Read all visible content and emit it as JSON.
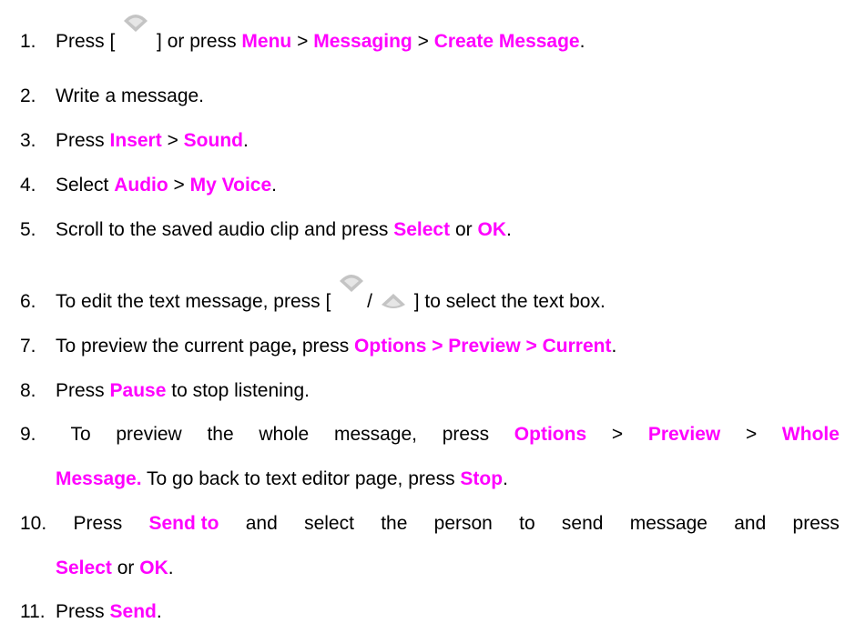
{
  "steps": [
    {
      "num": "1.",
      "t1": "Press [",
      "t2": "] or press",
      "h1": "Menu",
      "sep1": ">",
      "h2": "Messaging",
      "sep2": ">",
      "h3": "Create Message",
      "end": ".",
      "icon": "nav-up-key-icon"
    },
    {
      "num": "2.",
      "t1": "Write a message."
    },
    {
      "num": "3.",
      "t1": "Press",
      "h1": "Insert",
      "sep1": ">",
      "h2": "Sound",
      "end": "."
    },
    {
      "num": "4.",
      "t1": "Select",
      "h1": "Audio",
      "sep1": ">",
      "h2": "My Voice",
      "end": "."
    },
    {
      "num": "5.",
      "t1": "Scroll to the saved audio clip and press",
      "h1": "Select",
      "t2": "or",
      "h2": "OK",
      "end": "."
    },
    {
      "num": "6.",
      "t1": "To edit the text message, press [",
      "slash": "/",
      "t2": "] to select the text box.",
      "icon1": "nav-up-key-icon",
      "icon2": "nav-down-key-icon"
    },
    {
      "num": "7.",
      "t1": "To preview the current page",
      "comma": ",",
      "t2": "press",
      "h1": "Options > Preview > Current",
      "end": "."
    },
    {
      "num": "8.",
      "t1": "Press",
      "h1": "Pause",
      "t2": "to stop listening."
    },
    {
      "num": "9.",
      "line1": [
        "To",
        "preview",
        "the",
        "whole",
        "message,",
        "press"
      ],
      "h1": "Options",
      "sep1": ">",
      "h2": "Preview",
      "sep2": ">",
      "h3": "Whole",
      "h4": "Message.",
      "t2": "To go back to text editor page, press",
      "h5": "Stop",
      "end": "."
    },
    {
      "num": "10.",
      "t1": "Press",
      "h1": "Send to",
      "line1": [
        "and",
        "select",
        "the",
        "person",
        "to",
        "send",
        "message",
        "and",
        "press"
      ],
      "h2": "Select",
      "t2": "or",
      "h3": "OK",
      "end": "."
    },
    {
      "num": "11.",
      "t1": "Press",
      "h1": "Send",
      "end": "."
    }
  ],
  "colors": {
    "highlight": "#ff00ff",
    "text": "#000000",
    "icon": "#b8b8b8"
  }
}
